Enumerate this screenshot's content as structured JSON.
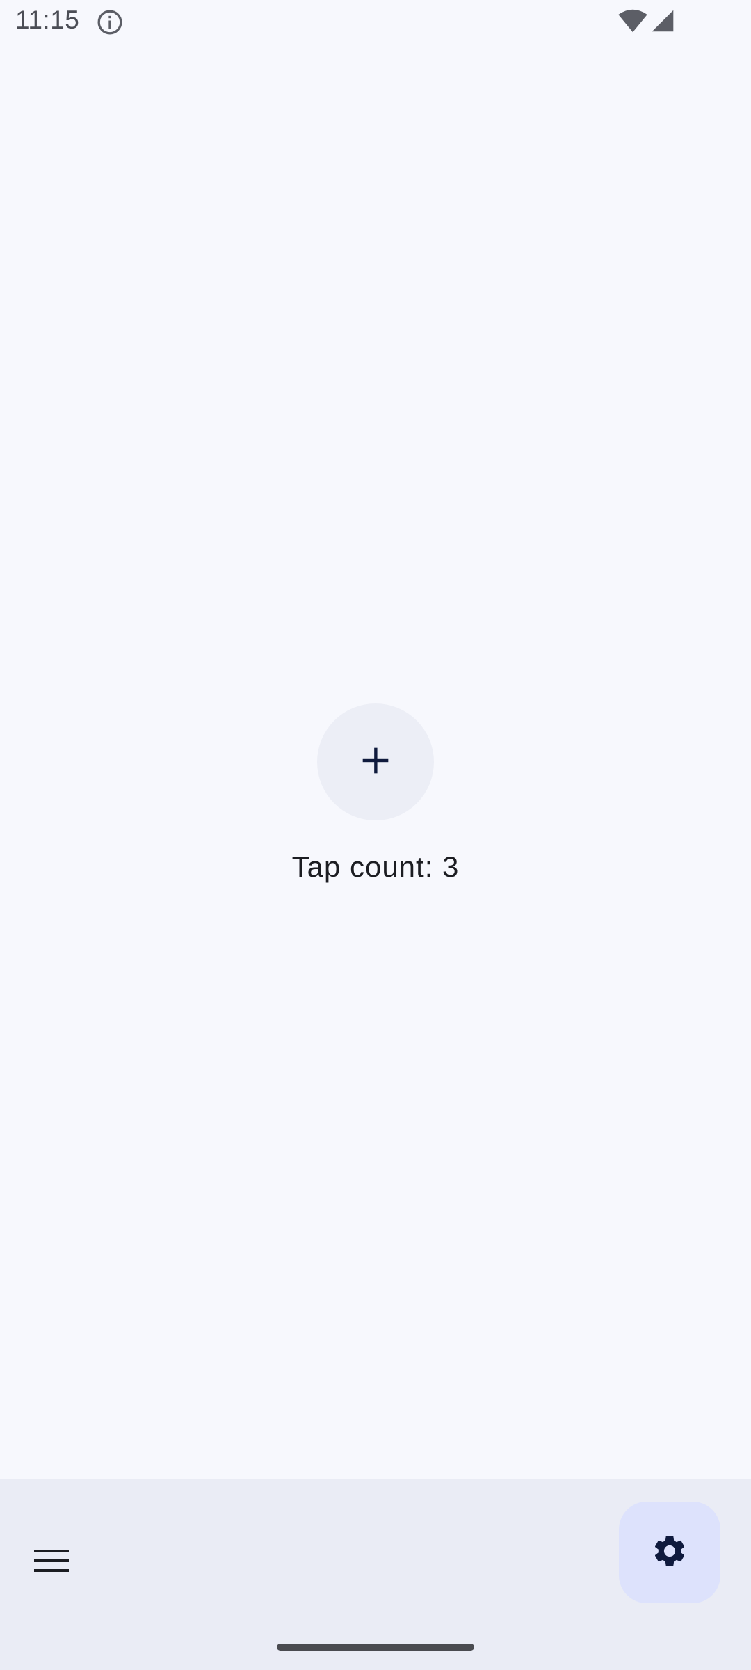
{
  "status_bar": {
    "time": "11:15",
    "icons": [
      "info-icon",
      "wifi-icon",
      "signal-icon"
    ]
  },
  "main": {
    "add_button_icon": "plus-icon",
    "tap_count_text": "Tap count: 3"
  },
  "bottom_bar": {
    "menu_icon": "menu-icon",
    "settings_icon": "gear-icon"
  },
  "colors": {
    "background": "#f7f8fd",
    "bottom_bar": "#eaecf5",
    "add_button": "#eceef6",
    "settings_fab": "#dde2fc",
    "icon_dark": "#0f1a3d"
  }
}
